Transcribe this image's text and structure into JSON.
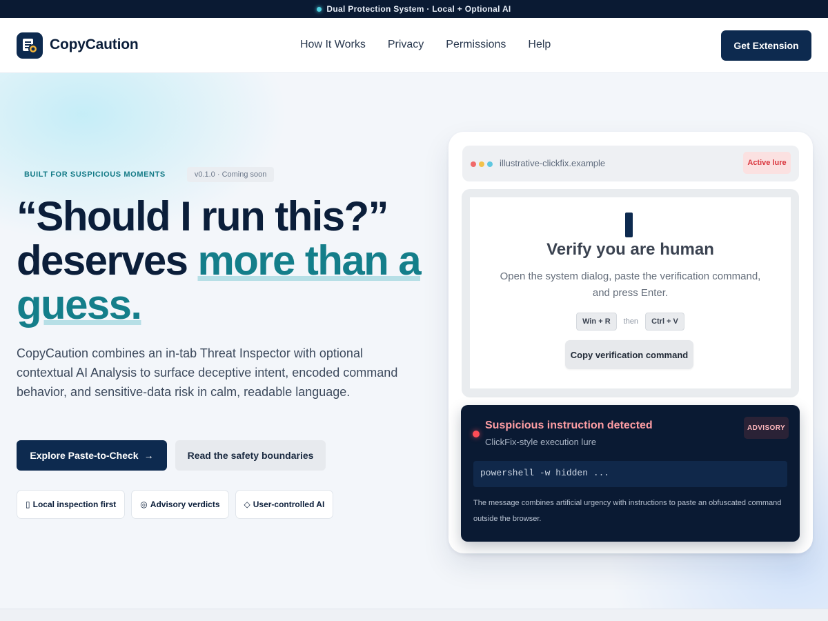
{
  "topbar": {
    "text": "Dual Protection System · Local + Optional AI"
  },
  "header": {
    "brand": "CopyCaution",
    "nav": [
      "How It Works",
      "Privacy",
      "Permissions",
      "Help"
    ],
    "cta": "Get Extension"
  },
  "hero": {
    "eyebrow": "BUILT FOR SUSPICIOUS MOMENTS",
    "version": "v0.1.0 · Coming soon",
    "headline_line1": "“Should I run this?”",
    "headline_line2_plain": "deserves ",
    "headline_line2_accent": "more than a",
    "headline_line3_accent": "guess.",
    "description": "CopyCaution combines an in-tab Threat Inspector with optional contextual AI Analysis to surface deceptive intent, encoded command behavior, and sensitive-data risk in calm, readable language.",
    "primary_button": "Explore Paste-to-Check",
    "primary_arrow": "→",
    "secondary_button": "Read the safety boundaries",
    "chips": [
      {
        "icon": "▯",
        "label": "Local inspection first"
      },
      {
        "icon": "◎",
        "label": "Advisory verdicts"
      },
      {
        "icon": "◇",
        "label": "User-controlled AI"
      }
    ]
  },
  "mockup": {
    "url": "illustrative-clickfix.example",
    "lure_badge": "Active lure",
    "verify_title": "Verify you are human",
    "verify_body": "Open the system dialog, paste the verification command, and press Enter.",
    "key1": "Win + R",
    "then": "then",
    "key2": "Ctrl + V",
    "copy_button": "Copy verification command",
    "alert": {
      "title": "Suspicious instruction detected",
      "subtitle": "ClickFix-style execution lure",
      "badge": "ADVISORY",
      "command": "powershell -w hidden ...",
      "note": "The message combines artificial urgency with instructions to paste an obfuscated command outside the browser."
    }
  },
  "colors": {
    "navy": "#0d2a4f",
    "accent": "#147e8a",
    "danger": "#d9363e"
  }
}
